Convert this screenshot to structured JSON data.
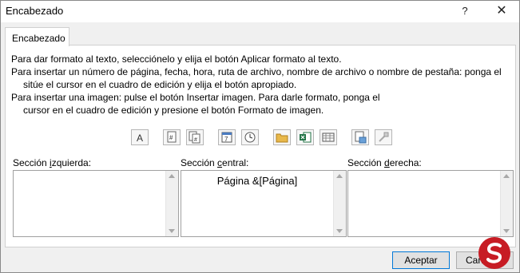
{
  "window": {
    "title": "Encabezado",
    "help_glyph": "?",
    "close_glyph": "✕"
  },
  "tabs": [
    {
      "label": "Encabezado"
    }
  ],
  "instructions": [
    "Para dar formato al texto, selecciónelo y elija el botón Aplicar formato al texto.",
    "Para insertar un número de página, fecha, hora, ruta de archivo, nombre de archivo o nombre de pestaña: ponga el",
    "sitúe el cursor en el cuadro de edición y elija el botón apropiado.",
    "Para insertar una imagen: pulse el botón Insertar imagen. Para darle formato, ponga el",
    "cursor en el cuadro de edición y presione el botón Formato de imagen."
  ],
  "toolbar": {
    "format_text_glyph": "A",
    "page_number_glyph": "#",
    "page_count_glyph": "#",
    "date_glyph": "7",
    "buttons": [
      {
        "name": "format-text",
        "icon": "letter-a-icon"
      },
      {
        "name": "page-number",
        "icon": "page-number-icon"
      },
      {
        "name": "page-count",
        "icon": "page-count-icon"
      },
      {
        "name": "date",
        "icon": "calendar-icon"
      },
      {
        "name": "time",
        "icon": "clock-icon"
      },
      {
        "name": "file-path",
        "icon": "folder-icon"
      },
      {
        "name": "file-name",
        "icon": "excel-file-icon"
      },
      {
        "name": "sheet-name",
        "icon": "sheet-grid-icon"
      },
      {
        "name": "insert-picture",
        "icon": "picture-icon"
      },
      {
        "name": "format-picture",
        "icon": "format-picture-icon"
      }
    ]
  },
  "sections": {
    "left": {
      "label_pre": "Sección ",
      "label_access": "i",
      "label_post": "zquierda:",
      "value": ""
    },
    "center": {
      "label_pre": "Sección ",
      "label_access": "c",
      "label_post": "entral:",
      "value": "Página &[Página]"
    },
    "right": {
      "label_pre": "Sección ",
      "label_access": "d",
      "label_post": "erecha:",
      "value": ""
    }
  },
  "buttons": {
    "accept": "Aceptar",
    "cancel": "Cancelar"
  },
  "colors": {
    "accent": "#0078d7",
    "logo_red": "#c71c24"
  }
}
